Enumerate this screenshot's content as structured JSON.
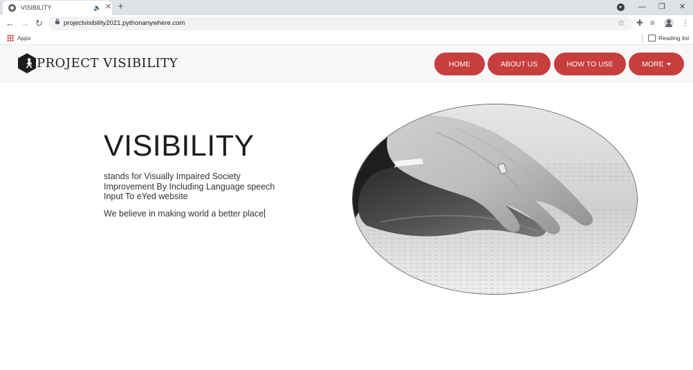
{
  "browser": {
    "tab_title": "VISIBILITY",
    "tab_audio": "🔈",
    "tab_close": "✕",
    "new_tab": "+",
    "url": "projectvisibility2021.pythonanywhere.com",
    "bookmarks": {
      "apps_label": "Apps",
      "reading_list_label": "Reading list"
    }
  },
  "header": {
    "logo_text": "PROJECT VISIBILITY",
    "nav": [
      {
        "label": "HOME"
      },
      {
        "label": "ABOUT US"
      },
      {
        "label": "HOW TO USE"
      },
      {
        "label": "MORE"
      }
    ],
    "accent_color": "#c73e3e"
  },
  "hero": {
    "title": "VISIBILITY",
    "description": "stands for Visually Impaired Society Improvement By Including Language speech Input To eYed website",
    "tagline": "We believe in making world a better place",
    "image_icon": "hands-reading-braille-photo"
  }
}
